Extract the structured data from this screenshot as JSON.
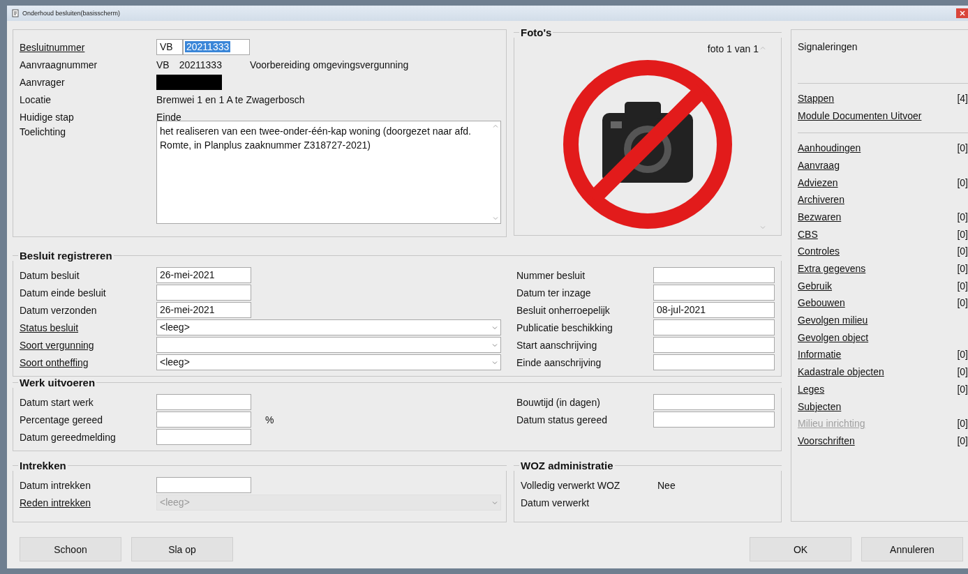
{
  "window": {
    "title": "Onderhoud besluiten(basisscherm)"
  },
  "summary": {
    "rows": [
      {
        "kind": "prefixed_field",
        "label": "Besluitnummer",
        "link": true,
        "prefix": "VB",
        "value": "20211333",
        "highlighted": true
      },
      {
        "kind": "text",
        "label": "Aanvraagnummer",
        "link": false,
        "values": [
          "VB",
          "20211333",
          "Voorbereiding omgevingsvergunning"
        ]
      },
      {
        "kind": "redacted",
        "label": "Aanvrager",
        "link": false
      },
      {
        "kind": "text",
        "label": "Locatie",
        "link": false,
        "values": [
          "Bremwei 1 en 1 A te Zwagerbosch"
        ]
      },
      {
        "kind": "text",
        "label": "Huidige stap",
        "link": false,
        "values": [
          "Einde"
        ]
      },
      {
        "kind": "memo",
        "label": "Toelichting",
        "link": false,
        "value": "het realiseren van een twee-onder-één-kap woning (doorgezet naar afd. Romte, in Planplus zaaknummer Z318727-2021)"
      }
    ]
  },
  "photos": {
    "title": "Foto's",
    "counter": "foto 1 van 1"
  },
  "besluit_registreren": {
    "title": "Besluit registreren",
    "left": [
      {
        "kind": "date",
        "label": "Datum besluit",
        "link": false,
        "value": "26-mei-2021"
      },
      {
        "kind": "date",
        "label": "Datum einde besluit",
        "link": false
      },
      {
        "kind": "date",
        "label": "Datum verzonden",
        "link": false,
        "value": "26-mei-2021"
      },
      {
        "kind": "combo",
        "label": "Status besluit",
        "link": true,
        "value": "<leeg>",
        "disabled": false
      },
      {
        "kind": "combo",
        "label": "Soort vergunning",
        "link": true,
        "disabled": false
      },
      {
        "kind": "combo",
        "label": "Soort ontheffing",
        "link": true,
        "value": "<leeg>",
        "disabled": false
      }
    ],
    "right": [
      {
        "kind": "wide",
        "label": "Nummer besluit",
        "link": false
      },
      {
        "kind": "wide",
        "label": "Datum ter inzage",
        "link": false
      },
      {
        "kind": "wide",
        "label": "Besluit onherroepelijk",
        "link": false,
        "value": "08-jul-2021"
      },
      {
        "kind": "wide",
        "label": "Publicatie beschikking",
        "link": false
      },
      {
        "kind": "wide",
        "label": "Start aanschrijving",
        "link": false
      },
      {
        "kind": "wide",
        "label": "Einde aanschrijving",
        "link": false
      }
    ]
  },
  "werk_uitvoeren": {
    "title": "Werk uitvoeren",
    "left": [
      {
        "kind": "date",
        "label": "Datum start werk",
        "link": false
      },
      {
        "kind": "date",
        "label": "Percentage gereed",
        "link": false,
        "suffix": "%"
      },
      {
        "kind": "date",
        "label": "Datum gereedmelding",
        "link": false
      }
    ],
    "right": [
      {
        "kind": "wide",
        "label": "Bouwtijd (in dagen)",
        "link": false
      },
      {
        "kind": "wide",
        "label": "Datum status gereed",
        "link": false
      }
    ]
  },
  "intrekken": {
    "title": "Intrekken",
    "rows": [
      {
        "kind": "date",
        "label": "Datum intrekken",
        "link": false
      },
      {
        "kind": "combo",
        "label": "Reden intrekken",
        "link": true,
        "value": "<leeg>",
        "disabled": true
      }
    ]
  },
  "woz_administratie": {
    "title": "WOZ administratie",
    "rows": [
      {
        "kind": "text",
        "label": "Volledig verwerkt WOZ",
        "link": false,
        "values": [
          "Nee"
        ]
      },
      {
        "kind": "text",
        "label": "Datum verwerkt",
        "link": false,
        "values": []
      }
    ]
  },
  "sidebar": {
    "title": "Signaleringen",
    "groups": [
      [
        {
          "label": "Stappen",
          "count": "[4]",
          "disabled": false
        },
        {
          "label": "Module Documenten Uitvoer",
          "disabled": false
        }
      ],
      [
        {
          "label": "Aanhoudingen",
          "count": "[0]",
          "disabled": false
        },
        {
          "label": "Aanvraag",
          "disabled": false
        },
        {
          "label": "Adviezen",
          "count": "[0]",
          "disabled": false
        },
        {
          "label": "Archiveren",
          "disabled": false
        },
        {
          "label": "Bezwaren",
          "count": "[0]",
          "disabled": false
        },
        {
          "label": "CBS",
          "count": "[0]",
          "disabled": false
        },
        {
          "label": "Controles",
          "count": "[0]",
          "disabled": false
        },
        {
          "label": "Extra gegevens",
          "count": "[0]",
          "disabled": false
        },
        {
          "label": "Gebruik",
          "count": "[0]",
          "disabled": false
        },
        {
          "label": "Gebouwen",
          "count": "[0]",
          "disabled": false
        },
        {
          "label": "Gevolgen milieu",
          "disabled": false
        },
        {
          "label": "Gevolgen object",
          "disabled": false
        },
        {
          "label": "Informatie",
          "count": "[0]",
          "disabled": false
        },
        {
          "label": "Kadastrale objecten",
          "count": "[0]",
          "disabled": false
        },
        {
          "label": "Leges",
          "count": "[0]",
          "disabled": false
        },
        {
          "label": "Subjecten",
          "disabled": false
        },
        {
          "label": "Milieu inrichting",
          "count": "[0]",
          "disabled": true
        },
        {
          "label": "Voorschriften",
          "count": "[0]",
          "disabled": false
        }
      ]
    ]
  },
  "buttons": {
    "left": [
      "Schoon",
      "Sla op"
    ],
    "right": [
      "OK",
      "Annuleren"
    ]
  }
}
